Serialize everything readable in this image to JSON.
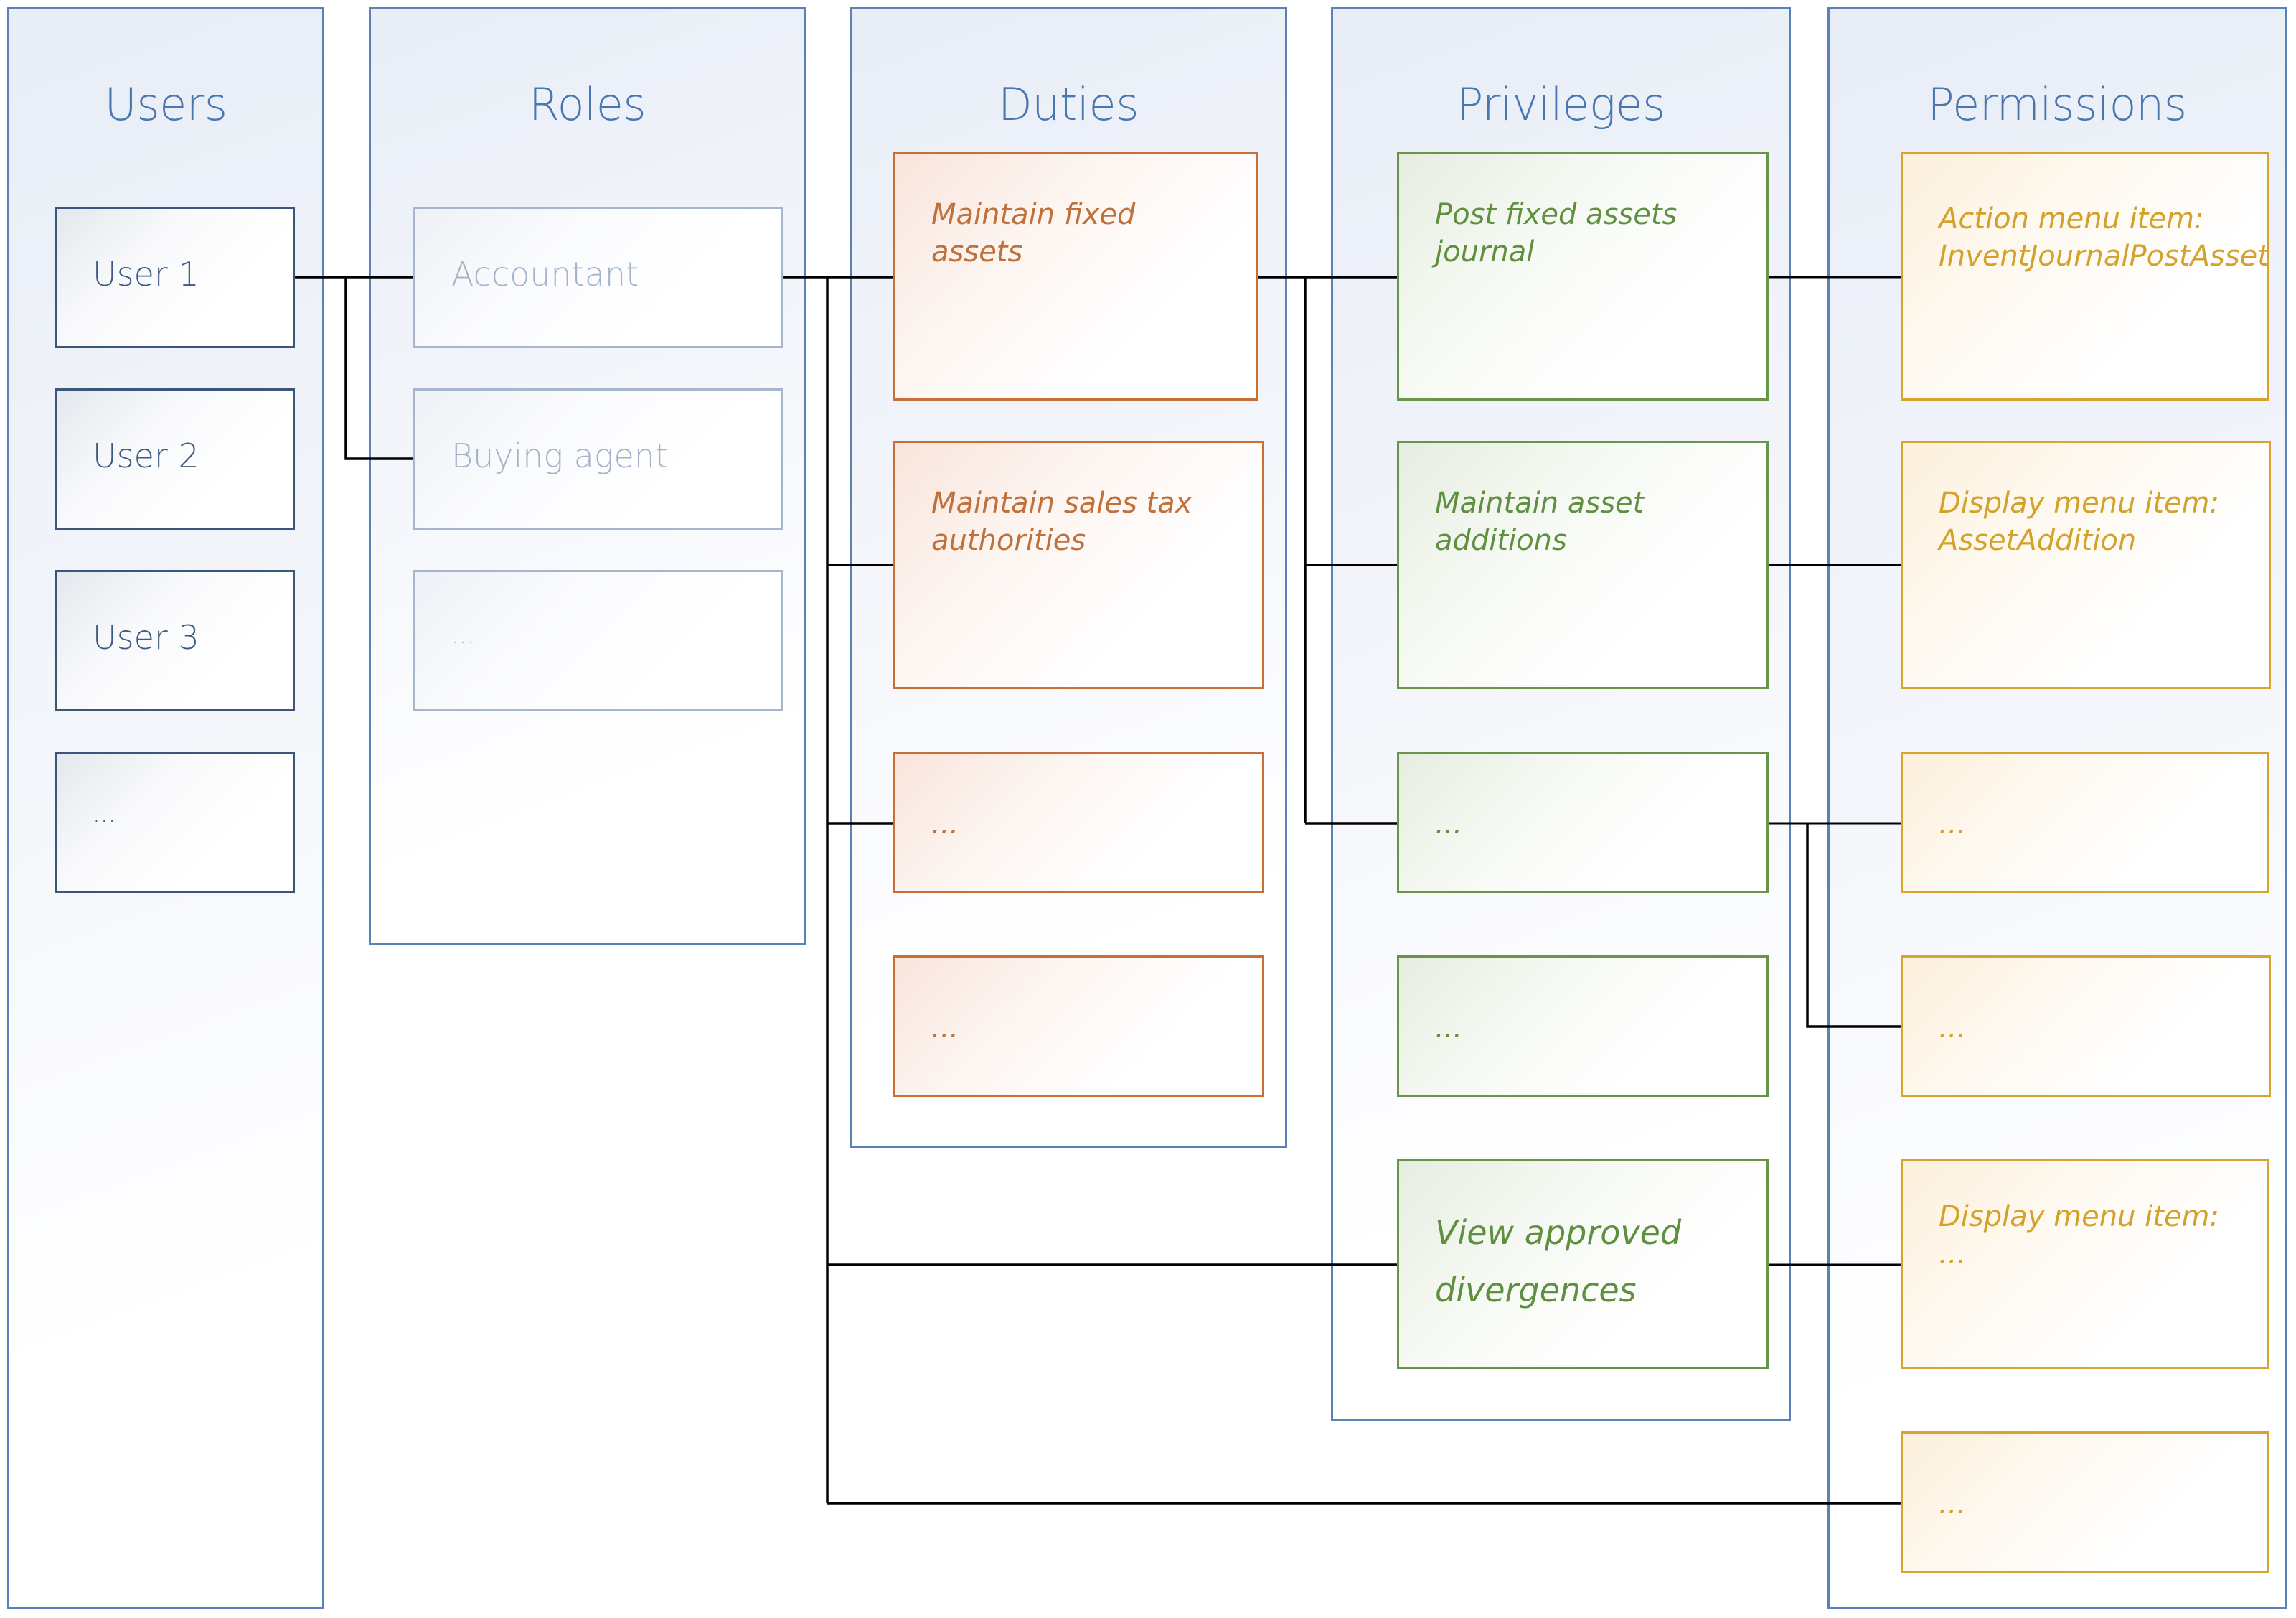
{
  "columns": {
    "users": {
      "title": "Users"
    },
    "roles": {
      "title": "Roles"
    },
    "duties": {
      "title": "Duties"
    },
    "privileges": {
      "title": "Privileges"
    },
    "permissions": {
      "title": "Permissions"
    }
  },
  "users": [
    "User 1",
    "User 2",
    "User 3",
    "..."
  ],
  "roles": [
    "Accountant",
    "Buying agent",
    "..."
  ],
  "duties": [
    "Maintain fixed\nassets",
    "Maintain sales tax\nauthorities",
    "...",
    "..."
  ],
  "privileges": [
    "Post fixed assets\njournal",
    "Maintain asset\nadditions",
    "...",
    "...",
    "View approved\ndivergences"
  ],
  "permissions": [
    "Action menu item:\nInventJournalPostAsset",
    "Display menu item:\nAssetAddition",
    "...",
    "...",
    "Display menu item:\n...",
    "..."
  ],
  "colors": {
    "column_border": "#5b82b8",
    "title": "#4a76b0",
    "user": "#3a5679",
    "role": "#a8b6cb",
    "duty": "#c76f34",
    "privilege": "#68954a",
    "permission": "#d8a430",
    "connector": "#000000"
  },
  "connections": [
    {
      "from": "User 1",
      "to": "Accountant"
    },
    {
      "from": "User 1",
      "to": "Buying agent"
    },
    {
      "from": "Accountant",
      "to": "Maintain fixed assets"
    },
    {
      "from": "Accountant",
      "to": "Maintain sales tax authorities"
    },
    {
      "from": "Accountant",
      "to": "duty ..."
    },
    {
      "from": "Accountant",
      "to": "View approved divergences"
    },
    {
      "from": "Accountant",
      "to": "permission ... (last)"
    },
    {
      "from": "Maintain fixed assets",
      "to": "Post fixed assets journal"
    },
    {
      "from": "Maintain fixed assets",
      "to": "Maintain asset additions"
    },
    {
      "from": "Maintain fixed assets",
      "to": "privilege ..."
    },
    {
      "from": "Post fixed assets journal",
      "to": "Action menu item: InventJournalPostAsset"
    },
    {
      "from": "Maintain asset additions",
      "to": "Display menu item: AssetAddition"
    },
    {
      "from": "privilege ...",
      "to": "permission ..."
    },
    {
      "from": "privilege ...",
      "to": "permission ... (second)"
    },
    {
      "from": "View approved divergences",
      "to": "Display menu item: ..."
    }
  ]
}
